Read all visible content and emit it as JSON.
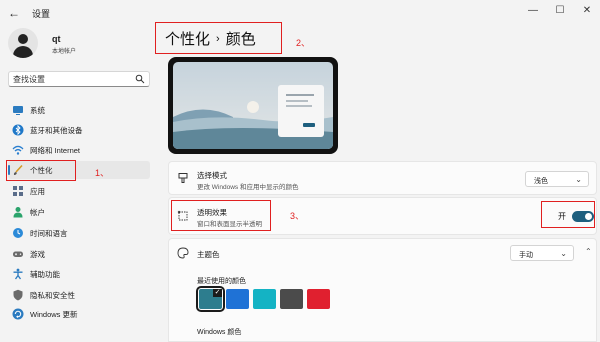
{
  "window": {
    "title": "设置",
    "back_icon": "back-arrow-icon",
    "controls": [
      "minimize-icon",
      "maximize-icon",
      "close-icon"
    ]
  },
  "profile": {
    "name": "qt",
    "subtitle": "本地帐户"
  },
  "search": {
    "placeholder": "查找设置"
  },
  "sidebar": {
    "items": [
      {
        "label": "系统",
        "icon": "monitor-icon",
        "color": "#2b7bc0"
      },
      {
        "label": "蓝牙和其他设备",
        "icon": "bluetooth-icon",
        "color": "#1f78c8"
      },
      {
        "label": "网络和 Internet",
        "icon": "wifi-icon",
        "color": "#2a7fd0"
      },
      {
        "label": "个性化",
        "icon": "brush-icon",
        "color": "#d49a24",
        "active": true
      },
      {
        "label": "应用",
        "icon": "apps-icon",
        "color": "#5a6d8a"
      },
      {
        "label": "帐户",
        "icon": "person-icon",
        "color": "#2aa36b"
      },
      {
        "label": "时间和语言",
        "icon": "globe-clock-icon",
        "color": "#2b8ad8"
      },
      {
        "label": "游戏",
        "icon": "gamepad-icon",
        "color": "#6b6b6b"
      },
      {
        "label": "辅助功能",
        "icon": "accessibility-icon",
        "color": "#2b7bc0"
      },
      {
        "label": "隐私和安全性",
        "icon": "shield-icon",
        "color": "#6b6b6b"
      },
      {
        "label": "Windows 更新",
        "icon": "update-icon",
        "color": "#2b7bc0"
      }
    ]
  },
  "breadcrumb": {
    "parent": "个性化",
    "separator": "›",
    "current": "颜色"
  },
  "annotations": {
    "one": "1、",
    "two": "2、",
    "three": "3、"
  },
  "settings": {
    "mode": {
      "title": "选择模式",
      "desc": "更改 Windows 和应用中显示的颜色",
      "value": "浅色",
      "icon": "palette-brush-icon"
    },
    "transparency": {
      "title": "透明效果",
      "desc": "窗口和表面显示半透明",
      "state_label": "开",
      "on": true,
      "icon": "transparency-icon"
    },
    "accent": {
      "title": "主题色",
      "value": "手动",
      "icon": "accent-palette-icon",
      "recent_label": "最近使用的颜色",
      "windows_label": "Windows 颜色",
      "recent_colors": [
        "#2d7d8e",
        "#1f72d6",
        "#14b3c4",
        "#4b4b4b",
        "#e0202f"
      ],
      "selected_index": 0
    }
  },
  "colors": {
    "accent": "#1e5f7e",
    "highlight_box": "#e02020"
  }
}
